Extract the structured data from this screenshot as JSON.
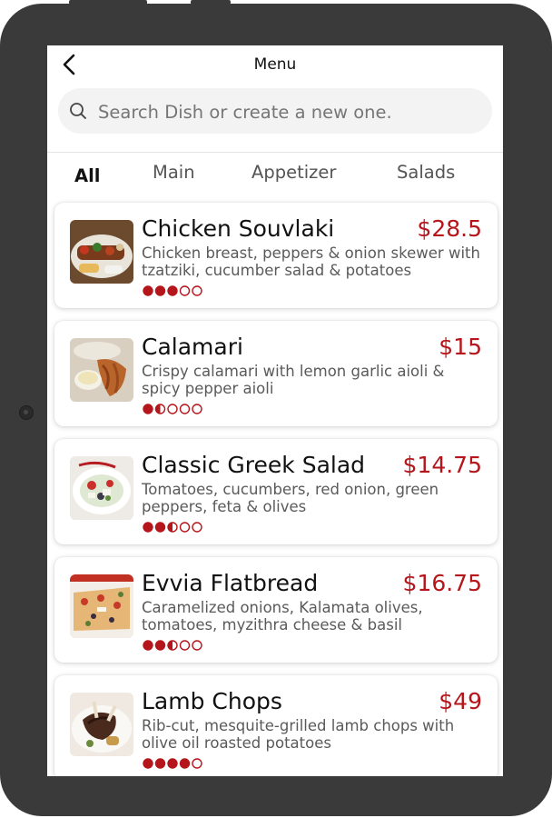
{
  "header": {
    "title": "Menu"
  },
  "search": {
    "placeholder": "Search Dish or create a new one."
  },
  "tabs": [
    {
      "label": "All",
      "active": true
    },
    {
      "label": "Main",
      "active": false
    },
    {
      "label": "Appetizer",
      "active": false
    },
    {
      "label": "Salads",
      "active": false
    }
  ],
  "colors": {
    "accent": "#b5161b",
    "device_frame": "#3a3a3a",
    "search_bg": "#f3f3f3"
  },
  "dishes": [
    {
      "name": "Chicken Souvlaki",
      "price": "$28.5",
      "description": "Chicken breast, peppers & onion skewer with tzatziki, cucumber salad & potatoes",
      "rating": 3,
      "rating_max": 5,
      "image_icon": "skewer-plate-icon"
    },
    {
      "name": "Calamari",
      "price": "$15",
      "description": "Crispy calamari with lemon garlic aioli & spicy pepper aioli",
      "rating": 1.5,
      "rating_max": 5,
      "image_icon": "fried-calamari-icon"
    },
    {
      "name": "Classic Greek Salad",
      "price": "$14.75",
      "description": "Tomatoes, cucumbers, red onion, green peppers, feta & olives",
      "rating": 2.5,
      "rating_max": 5,
      "image_icon": "salad-bowl-icon"
    },
    {
      "name": "Evvia Flatbread",
      "price": "$16.75",
      "description": "Caramelized onions, Kalamata olives, tomatoes, myzithra cheese & basil",
      "rating": 2.5,
      "rating_max": 5,
      "image_icon": "flatbread-icon"
    },
    {
      "name": "Lamb Chops",
      "price": "$49",
      "description": "Rib-cut, mesquite-grilled lamb chops with olive oil roasted potatoes",
      "rating": 4,
      "rating_max": 5,
      "image_icon": "lamb-chops-icon"
    }
  ]
}
